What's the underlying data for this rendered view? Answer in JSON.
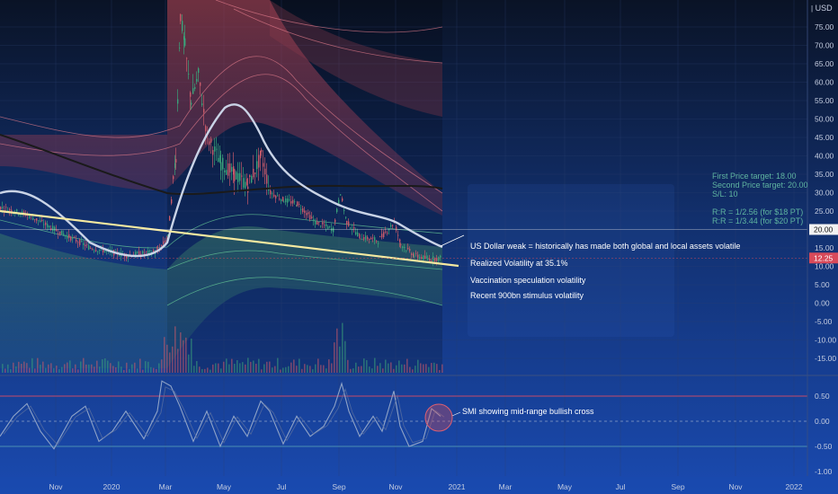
{
  "currency": "USD",
  "price_axis": {
    "ticks": [
      "75.00",
      "70.00",
      "65.00",
      "60.00",
      "55.00",
      "50.00",
      "45.00",
      "40.00",
      "35.00",
      "30.00",
      "25.00",
      "20.00",
      "15.00",
      "10.00",
      "5.00",
      "0.00",
      "-5.00",
      "-10.00",
      "-15.00"
    ],
    "tick_values": [
      75,
      70,
      65,
      60,
      55,
      50,
      45,
      40,
      35,
      30,
      25,
      20,
      15,
      10,
      5,
      0,
      -5,
      -10,
      -15
    ],
    "current_price_label": "12.25",
    "current_price": 12.25,
    "target_line_label": "20.00",
    "target_line": 20
  },
  "indicator_axis": {
    "ticks": [
      "0.50",
      "0.00",
      "-0.50",
      "-1.00"
    ],
    "tick_values": [
      0.5,
      0,
      -0.5,
      -1
    ]
  },
  "time_axis": {
    "labels": [
      "Nov",
      "2020",
      "Mar",
      "May",
      "Jul",
      "Sep",
      "Nov",
      "2021",
      "Mar",
      "May",
      "Jul",
      "Sep",
      "Nov",
      "2022"
    ]
  },
  "annotations": {
    "targets": {
      "first": "First Price target: 18.00",
      "second": "Second Price target: 20.00",
      "stop_loss": "S/L: 10",
      "rr1": "R:R = 1/2.56 (for $18 PT)",
      "rr2": "R:R = 1/3.44 (for $20 PT)"
    },
    "notes": [
      "US Dollar weak = historically has made both global and local assets volatile",
      "Realized Volatility at 35.1%",
      "Vaccination speculation volatility",
      "Recent 900bn stimulus volatility"
    ],
    "smi_note": "SMI showing mid-range bullish cross"
  },
  "colors": {
    "background_top": "#0a1326",
    "background_bottom": "#1a4ab0",
    "grid": "#2a3f6e",
    "trendline": "#f5e9a0",
    "ma_fast": "#c9d3e6",
    "ma_slow": "#1a1a1a",
    "band_upper": "#8a3a4a",
    "band_lower": "#3a8a5a",
    "candle_up": "#3aa37a",
    "candle_down": "#c85a6a",
    "price_tag": "#d84a5a",
    "target_text": "#5fb4a0",
    "smi_line": "#8fa3c7",
    "smi_upper": "#c44a6a",
    "smi_lower": "#4a8fb4"
  }
}
